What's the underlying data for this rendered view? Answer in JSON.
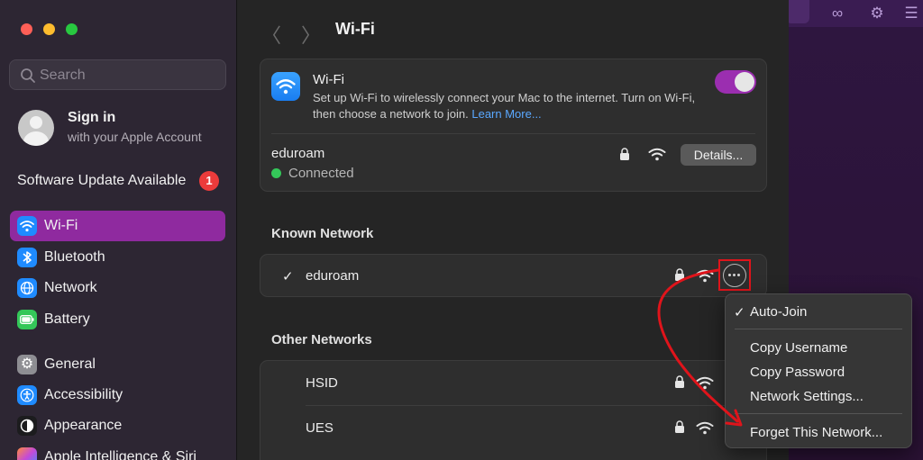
{
  "sidebar": {
    "search_placeholder": "Search",
    "account": {
      "name": "Sign in",
      "subtitle": "with your Apple Account"
    },
    "update": {
      "label": "Software Update Available",
      "badge": "1"
    },
    "items": [
      {
        "label": "Wi-Fi",
        "icon": "wifi-icon",
        "color": "#1f8bff"
      },
      {
        "label": "Bluetooth",
        "icon": "bluetooth-icon",
        "color": "#1f8bff"
      },
      {
        "label": "Network",
        "icon": "globe-icon",
        "color": "#1f8bff"
      },
      {
        "label": "Battery",
        "icon": "battery-icon",
        "color": "#34c759"
      },
      {
        "label": "General",
        "icon": "gear-icon",
        "color": "#8e8e93"
      },
      {
        "label": "Accessibility",
        "icon": "accessibility-icon",
        "color": "#1f8bff"
      },
      {
        "label": "Appearance",
        "icon": "appearance-icon",
        "color": "#1c1c1e"
      },
      {
        "label": "Apple Intelligence & Siri",
        "icon": "siri-icon",
        "color": "#c44ad8"
      }
    ]
  },
  "main": {
    "title": "Wi-Fi",
    "wifi_card": {
      "title": "Wi-Fi",
      "description": "Set up Wi-Fi to wirelessly connect your Mac to the internet. Turn on Wi-Fi, then choose a network to join.",
      "learn_more": "Learn More...",
      "toggle_on": true,
      "current_network": "eduroam",
      "status": "Connected",
      "details_button": "Details..."
    },
    "known_header": "Known Network",
    "known_networks": [
      {
        "name": "eduroam",
        "checkmark": "✓"
      }
    ],
    "other_header": "Other Networks",
    "other_networks": [
      {
        "name": "HSID"
      },
      {
        "name": "UES"
      }
    ]
  },
  "menu": {
    "items": [
      "Auto-Join",
      "Copy Username",
      "Copy Password",
      "Network Settings...",
      "Forget This Network..."
    ],
    "checked": "✓"
  },
  "colors": {
    "accent": "#9b2eb0",
    "annotation": "#e0141b"
  }
}
